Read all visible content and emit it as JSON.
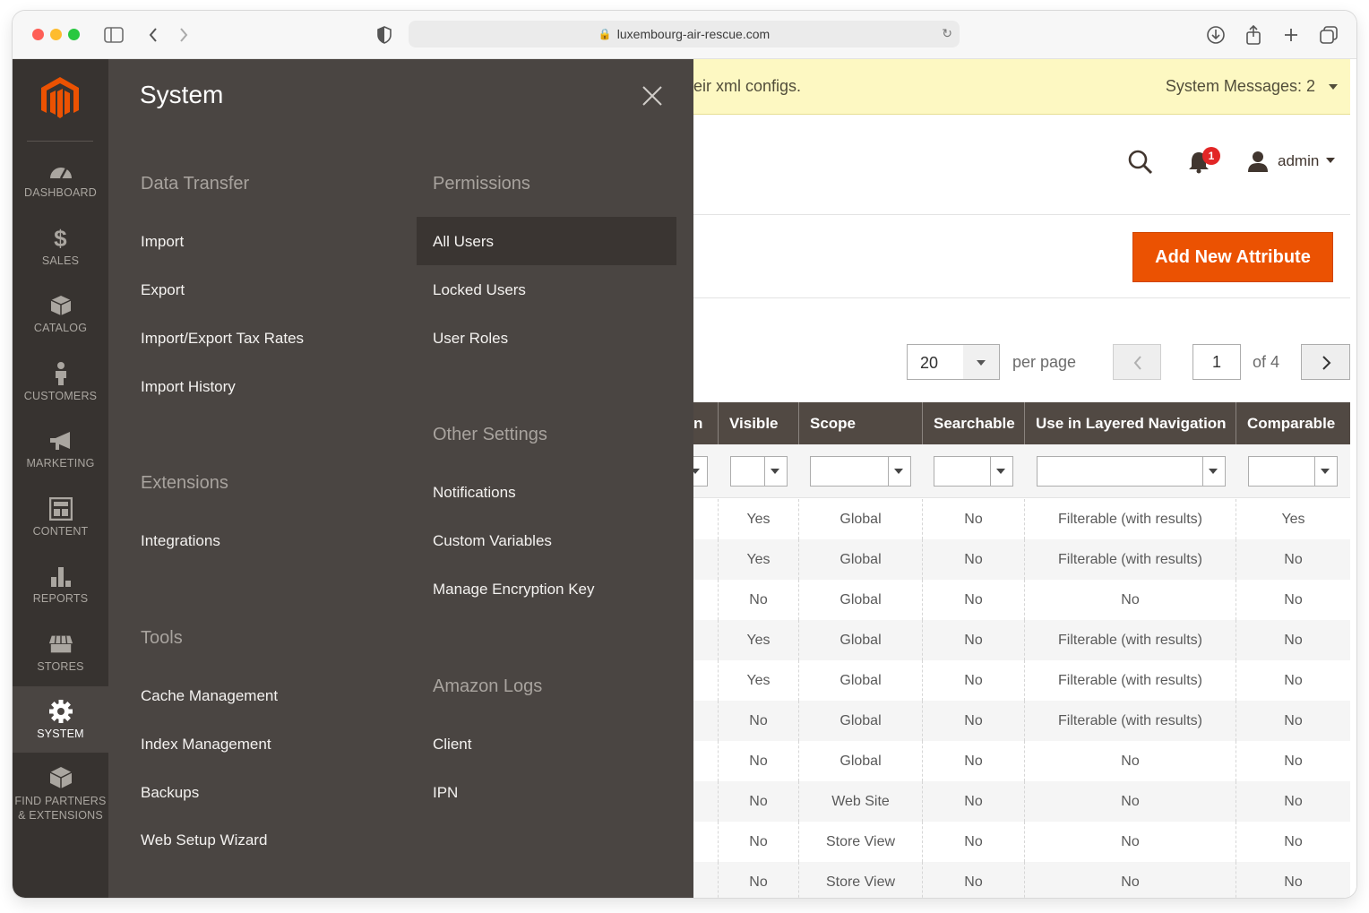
{
  "browser": {
    "url": "luxembourg-air-rescue.com"
  },
  "admin_nav": {
    "items": [
      {
        "id": "dashboard",
        "label": "DASHBOARD",
        "icon": "dashboard-icon"
      },
      {
        "id": "sales",
        "label": "SALES",
        "icon": "dollar-icon"
      },
      {
        "id": "catalog",
        "label": "CATALOG",
        "icon": "box-icon"
      },
      {
        "id": "customers",
        "label": "CUSTOMERS",
        "icon": "person-icon"
      },
      {
        "id": "marketing",
        "label": "MARKETING",
        "icon": "megaphone-icon"
      },
      {
        "id": "content",
        "label": "CONTENT",
        "icon": "layout-icon"
      },
      {
        "id": "reports",
        "label": "REPORTS",
        "icon": "bar-chart-icon"
      },
      {
        "id": "stores",
        "label": "STORES",
        "icon": "store-icon"
      },
      {
        "id": "system",
        "label": "SYSTEM",
        "icon": "gear-icon",
        "active": true
      },
      {
        "id": "partners",
        "label": "FIND PARTNERS",
        "label2": "& EXTENSIONS",
        "icon": "cube-icon"
      }
    ]
  },
  "submenu": {
    "title": "System",
    "left_sections": [
      {
        "heading": "Data Transfer",
        "links": [
          "Import",
          "Export",
          "Import/Export Tax Rates",
          "Import History"
        ]
      },
      {
        "heading": "Extensions",
        "links": [
          "Integrations"
        ]
      },
      {
        "heading": "Tools",
        "links": [
          "Cache Management",
          "Index Management",
          "Backups",
          "Web Setup Wizard"
        ]
      }
    ],
    "right_sections": [
      {
        "heading": "Permissions",
        "links": [
          "All Users",
          "Locked Users",
          "User Roles"
        ]
      },
      {
        "heading": "Other Settings",
        "links": [
          "Notifications",
          "Custom Variables",
          "Manage Encryption Key"
        ]
      },
      {
        "heading": "Amazon Logs",
        "links": [
          "Client",
          "IPN"
        ]
      }
    ]
  },
  "message_bar": {
    "text": "eir xml configs.",
    "system_messages": "System Messages: 2"
  },
  "header": {
    "notification_count": "1",
    "user": "admin"
  },
  "actions": {
    "add_button": "Add New Attribute"
  },
  "pager": {
    "per_page_value": "20",
    "per_page_label": "per page",
    "current_page": "1",
    "of_pages": "of 4"
  },
  "grid": {
    "partial_first_col": "n",
    "columns": [
      "Visible",
      "Scope",
      "Searchable",
      "Use in Layered Navigation",
      "Comparable"
    ],
    "rows": [
      [
        "Yes",
        "Global",
        "No",
        "Filterable (with results)",
        "Yes"
      ],
      [
        "Yes",
        "Global",
        "No",
        "Filterable (with results)",
        "No"
      ],
      [
        "No",
        "Global",
        "No",
        "No",
        "No"
      ],
      [
        "Yes",
        "Global",
        "No",
        "Filterable (with results)",
        "No"
      ],
      [
        "Yes",
        "Global",
        "No",
        "Filterable (with results)",
        "No"
      ],
      [
        "No",
        "Global",
        "No",
        "Filterable (with results)",
        "No"
      ],
      [
        "No",
        "Global",
        "No",
        "No",
        "No"
      ],
      [
        "No",
        "Web Site",
        "No",
        "No",
        "No"
      ],
      [
        "No",
        "Store View",
        "No",
        "No",
        "No"
      ],
      [
        "No",
        "Store View",
        "No",
        "No",
        "No"
      ]
    ]
  },
  "colors": {
    "nav_bg": "#373330",
    "submenu_bg": "#4a4542",
    "accent": "#eb5202",
    "grid_header": "#514943",
    "message_bg": "#fdf8c2"
  }
}
